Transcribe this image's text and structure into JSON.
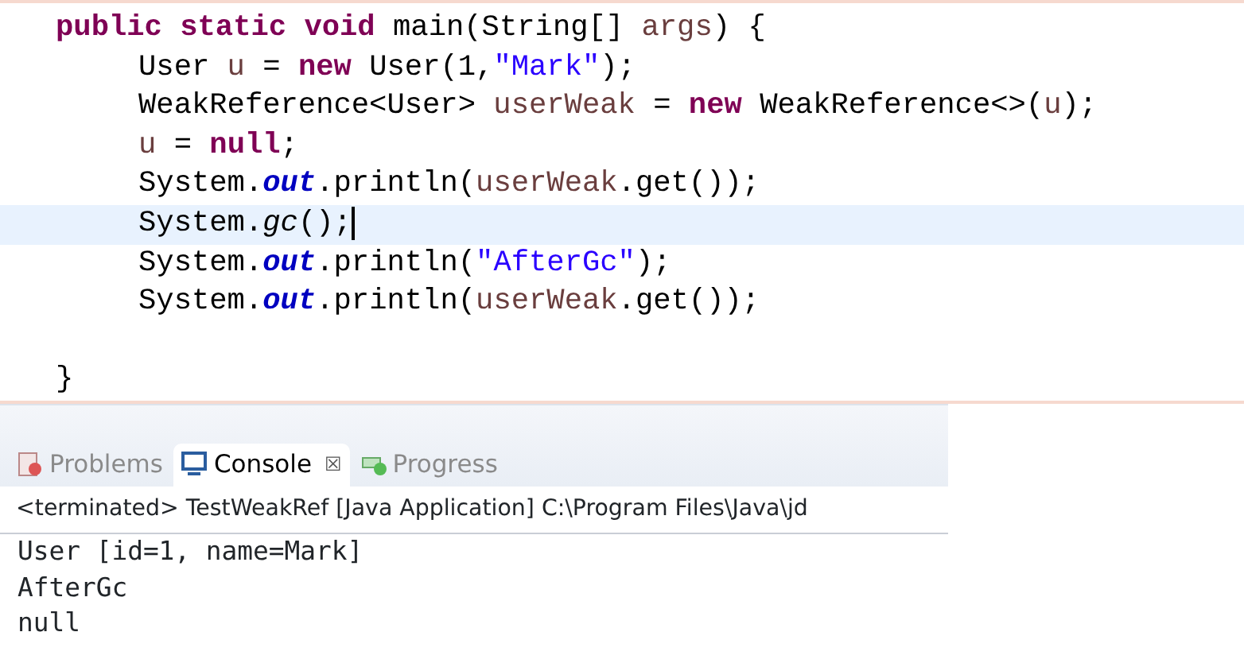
{
  "editor": {
    "lines": [
      {
        "current": false,
        "tokens": [
          {
            "kind": "keyword",
            "text": "public static void"
          },
          {
            "kind": "plain",
            "text": " main(String[] "
          },
          {
            "kind": "variable",
            "text": "args"
          },
          {
            "kind": "plain",
            "text": ") {"
          }
        ],
        "children": [
          {
            "current": false,
            "tokens": [
              {
                "kind": "plain",
                "text": "User "
              },
              {
                "kind": "variable",
                "text": "u"
              },
              {
                "kind": "plain",
                "text": " = "
              },
              {
                "kind": "keyword",
                "text": "new"
              },
              {
                "kind": "plain",
                "text": " User(1,"
              },
              {
                "kind": "string",
                "text": "\"Mark\""
              },
              {
                "kind": "plain",
                "text": ");"
              }
            ]
          },
          {
            "current": false,
            "tokens": [
              {
                "kind": "plain",
                "text": "WeakReference<User> "
              },
              {
                "kind": "variable",
                "text": "userWeak"
              },
              {
                "kind": "plain",
                "text": " = "
              },
              {
                "kind": "keyword",
                "text": "new"
              },
              {
                "kind": "plain",
                "text": " WeakReference<>("
              },
              {
                "kind": "variable",
                "text": "u"
              },
              {
                "kind": "plain",
                "text": ");"
              }
            ]
          },
          {
            "current": false,
            "tokens": [
              {
                "kind": "variable",
                "text": "u"
              },
              {
                "kind": "plain",
                "text": " = "
              },
              {
                "kind": "keyword",
                "text": "null"
              },
              {
                "kind": "plain",
                "text": ";"
              }
            ]
          },
          {
            "current": false,
            "tokens": [
              {
                "kind": "plain",
                "text": "System."
              },
              {
                "kind": "field",
                "text": "out"
              },
              {
                "kind": "plain",
                "text": ".println("
              },
              {
                "kind": "variable",
                "text": "userWeak"
              },
              {
                "kind": "plain",
                "text": ".get());"
              }
            ]
          },
          {
            "current": true,
            "tokens": [
              {
                "kind": "plain",
                "text": "System."
              },
              {
                "kind": "static",
                "text": "gc"
              },
              {
                "kind": "plain",
                "text": "();"
              }
            ]
          },
          {
            "current": false,
            "tokens": [
              {
                "kind": "plain",
                "text": "System."
              },
              {
                "kind": "field",
                "text": "out"
              },
              {
                "kind": "plain",
                "text": ".println("
              },
              {
                "kind": "string",
                "text": "\"AfterGc\""
              },
              {
                "kind": "plain",
                "text": ");"
              }
            ]
          },
          {
            "current": false,
            "tokens": [
              {
                "kind": "plain",
                "text": "System."
              },
              {
                "kind": "field",
                "text": "out"
              },
              {
                "kind": "plain",
                "text": ".println("
              },
              {
                "kind": "variable",
                "text": "userWeak"
              },
              {
                "kind": "plain",
                "text": ".get());"
              }
            ]
          }
        ]
      },
      {
        "current": false,
        "blank_before": true,
        "tokens": [
          {
            "kind": "plain",
            "text": "}"
          }
        ]
      }
    ]
  },
  "console": {
    "tabs": [
      {
        "kind": "problems",
        "label": "Problems",
        "selected": false
      },
      {
        "kind": "console",
        "label": "Console",
        "selected": true,
        "close": "☒"
      },
      {
        "kind": "progress",
        "label": "Progress",
        "selected": false
      }
    ],
    "header": "<terminated> TestWeakRef [Java Application] C:\\Program Files\\Java\\jd",
    "output": [
      "User [id=1, name=Mark]",
      "AfterGc",
      "null"
    ]
  }
}
